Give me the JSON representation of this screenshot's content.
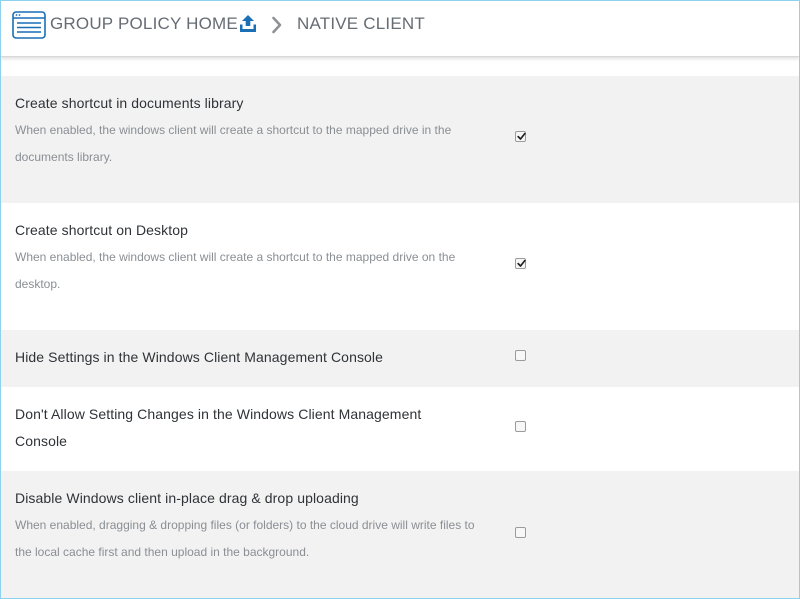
{
  "header": {
    "home_label": "GROUP POLICY HOME",
    "current_label": "NATIVE CLIENT",
    "accent_color": "#1a6fb5"
  },
  "settings": [
    {
      "title": "Create shortcut in documents library",
      "description": "When enabled, the windows client will create a shortcut to the mapped drive in the documents library.",
      "checked": true
    },
    {
      "title": "Create shortcut on Desktop",
      "description": "When enabled, the windows client will create a shortcut to the mapped drive on the desktop.",
      "checked": true
    },
    {
      "title": "Hide Settings in the Windows Client Management Console",
      "description": "",
      "checked": false
    },
    {
      "title": "Don't Allow Setting Changes in the Windows Client Management Console",
      "description": "",
      "checked": false
    },
    {
      "title": "Disable Windows client in-place drag & drop uploading",
      "description": "When enabled, dragging & dropping files (or folders) to the cloud drive will write files to the local cache first and then upload in the background.",
      "checked": false
    }
  ]
}
